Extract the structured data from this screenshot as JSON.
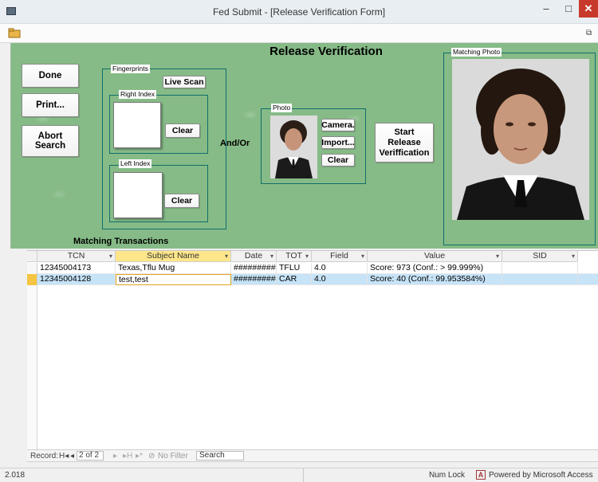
{
  "window": {
    "title": "Fed Submit - [Release Verification Form]",
    "minimize_glyph": "–",
    "maximize_glyph": "□",
    "close_glyph": "✕",
    "restore_glyph": "⧉"
  },
  "form": {
    "heading": "Release Verification",
    "buttons": {
      "done": "Done",
      "print": "Print...",
      "abort": "Abort Search",
      "live_scan": "Live Scan",
      "clear_right": "Clear",
      "clear_left": "Clear",
      "camera": "Camera.",
      "import": "Import...",
      "clear_photo": "Clear",
      "start": "Start Release Veriffication"
    },
    "labels": {
      "fingerprints": "Fingerprints",
      "right_index": "Right Index",
      "left_index": "Left Index",
      "and_or": "And/Or",
      "photo": "Photo",
      "matching_photo": "Matching Photo"
    }
  },
  "transactions": {
    "label": "Matching Transactions",
    "columns": [
      "TCN",
      "Subject Name",
      "Date",
      "TOT",
      "Field",
      "Value",
      "SID"
    ],
    "rows": [
      {
        "tcn": "12345004173",
        "subject": "Texas,Tflu Mug",
        "date": "##########",
        "tot": "TFLU",
        "field": "4.0",
        "value": "Score: 973 (Conf.: > 99.999%)",
        "sid": ""
      },
      {
        "tcn": "12345004128",
        "subject": "test,test",
        "date": "##########",
        "tot": "CAR",
        "field": "4.0",
        "value": "Score: 40 (Conf.: 99.953584%)",
        "sid": ""
      }
    ]
  },
  "navigator": {
    "record_label": "Record:",
    "first": "H◂",
    "prev": "◂",
    "position": "2 of 2",
    "next": "▸",
    "last": "▸H",
    "new": "▸*",
    "filter": "No Filter",
    "search": "Search"
  },
  "status": {
    "left": "2.018",
    "num_lock": "Num Lock",
    "powered_by": "Powered by Microsoft Access"
  },
  "colors": {
    "form_green": "#86bb87",
    "frame_teal": "#0f6e6b",
    "sort_header": "#fde68a",
    "selected_row": "#c6e3f7",
    "close_red": "#c7392b"
  }
}
